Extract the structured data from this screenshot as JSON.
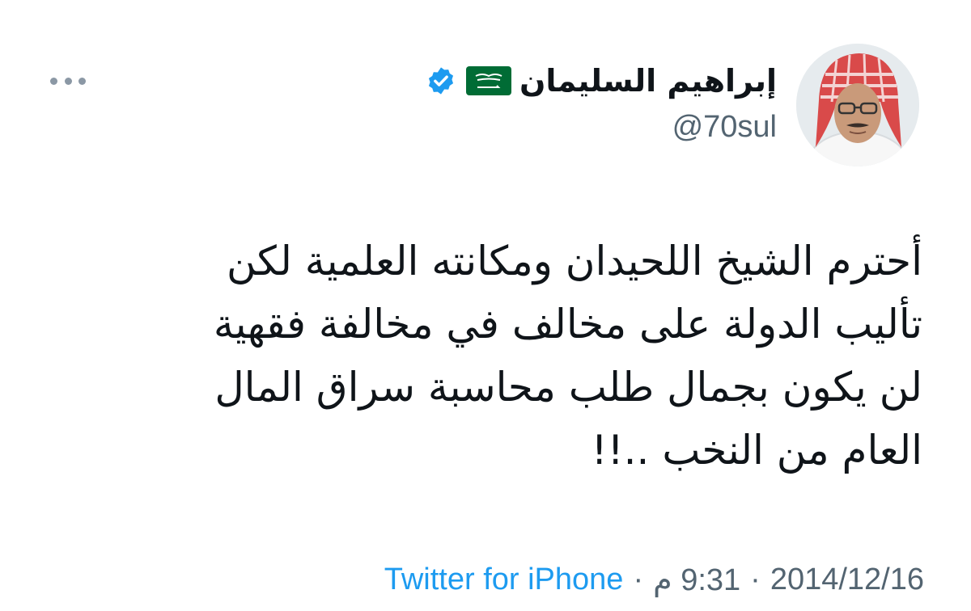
{
  "tweet": {
    "author": {
      "display_name": "إبراهيم السليمان",
      "handle": "@70sul",
      "flag_icon": "saudi-flag-icon",
      "verified_icon": "verified-badge-icon"
    },
    "more_icon": "more-options-icon",
    "text_lines": [
      "أحترم الشيخ اللحيدان ومكانته العلمية لكن",
      "تأليب الدولة على مخالف في مخالفة فقهية",
      "لن يكون بجمال طلب محاسبة سراق المال",
      "العام من النخب ..!!"
    ],
    "meta": {
      "source": "Twitter for iPhone",
      "separator": "·",
      "time": "9:31 م",
      "date": "2014/12/16"
    }
  },
  "colors": {
    "text": "#0f1419",
    "secondary": "#536471",
    "link": "#1d9bf0",
    "verified": "#1d9bf0",
    "flag_green": "#006c35"
  }
}
